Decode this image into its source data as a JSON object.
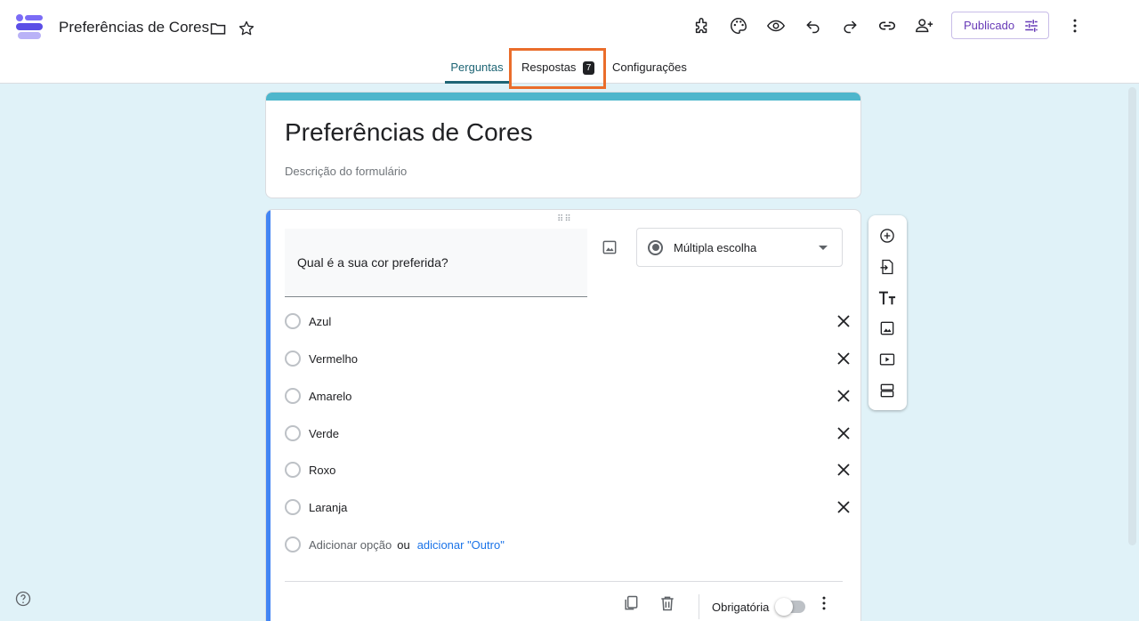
{
  "header": {
    "doc_title": "Preferências de Cores",
    "publish_label": "Publicado",
    "icons": [
      "addon-icon",
      "palette-icon",
      "preview-icon",
      "undo-icon",
      "redo-icon",
      "link-icon",
      "add-collaborator-icon",
      "more-vert-icon"
    ]
  },
  "tabs": {
    "questions": "Perguntas",
    "responses": "Respostas",
    "responses_count": "7",
    "settings": "Configurações"
  },
  "form": {
    "title": "Preferências de Cores",
    "description_placeholder": "Descrição do formulário"
  },
  "question": {
    "text": "Qual é a sua cor preferida?",
    "type": "Múltipla escolha",
    "options": [
      "Azul",
      "Vermelho",
      "Amarelo",
      "Verde",
      "Roxo",
      "Laranja"
    ],
    "add_option": "Adicionar opção",
    "or": "ou",
    "add_other": "adicionar \"Outro\"",
    "required_label": "Obrigatória",
    "required": false
  },
  "colors": {
    "accent": "#673ab7",
    "header_bar": "#4db6cc",
    "question_bar": "#4285f4",
    "highlight": "#ea6d2b",
    "background": "#e0f2f8"
  }
}
